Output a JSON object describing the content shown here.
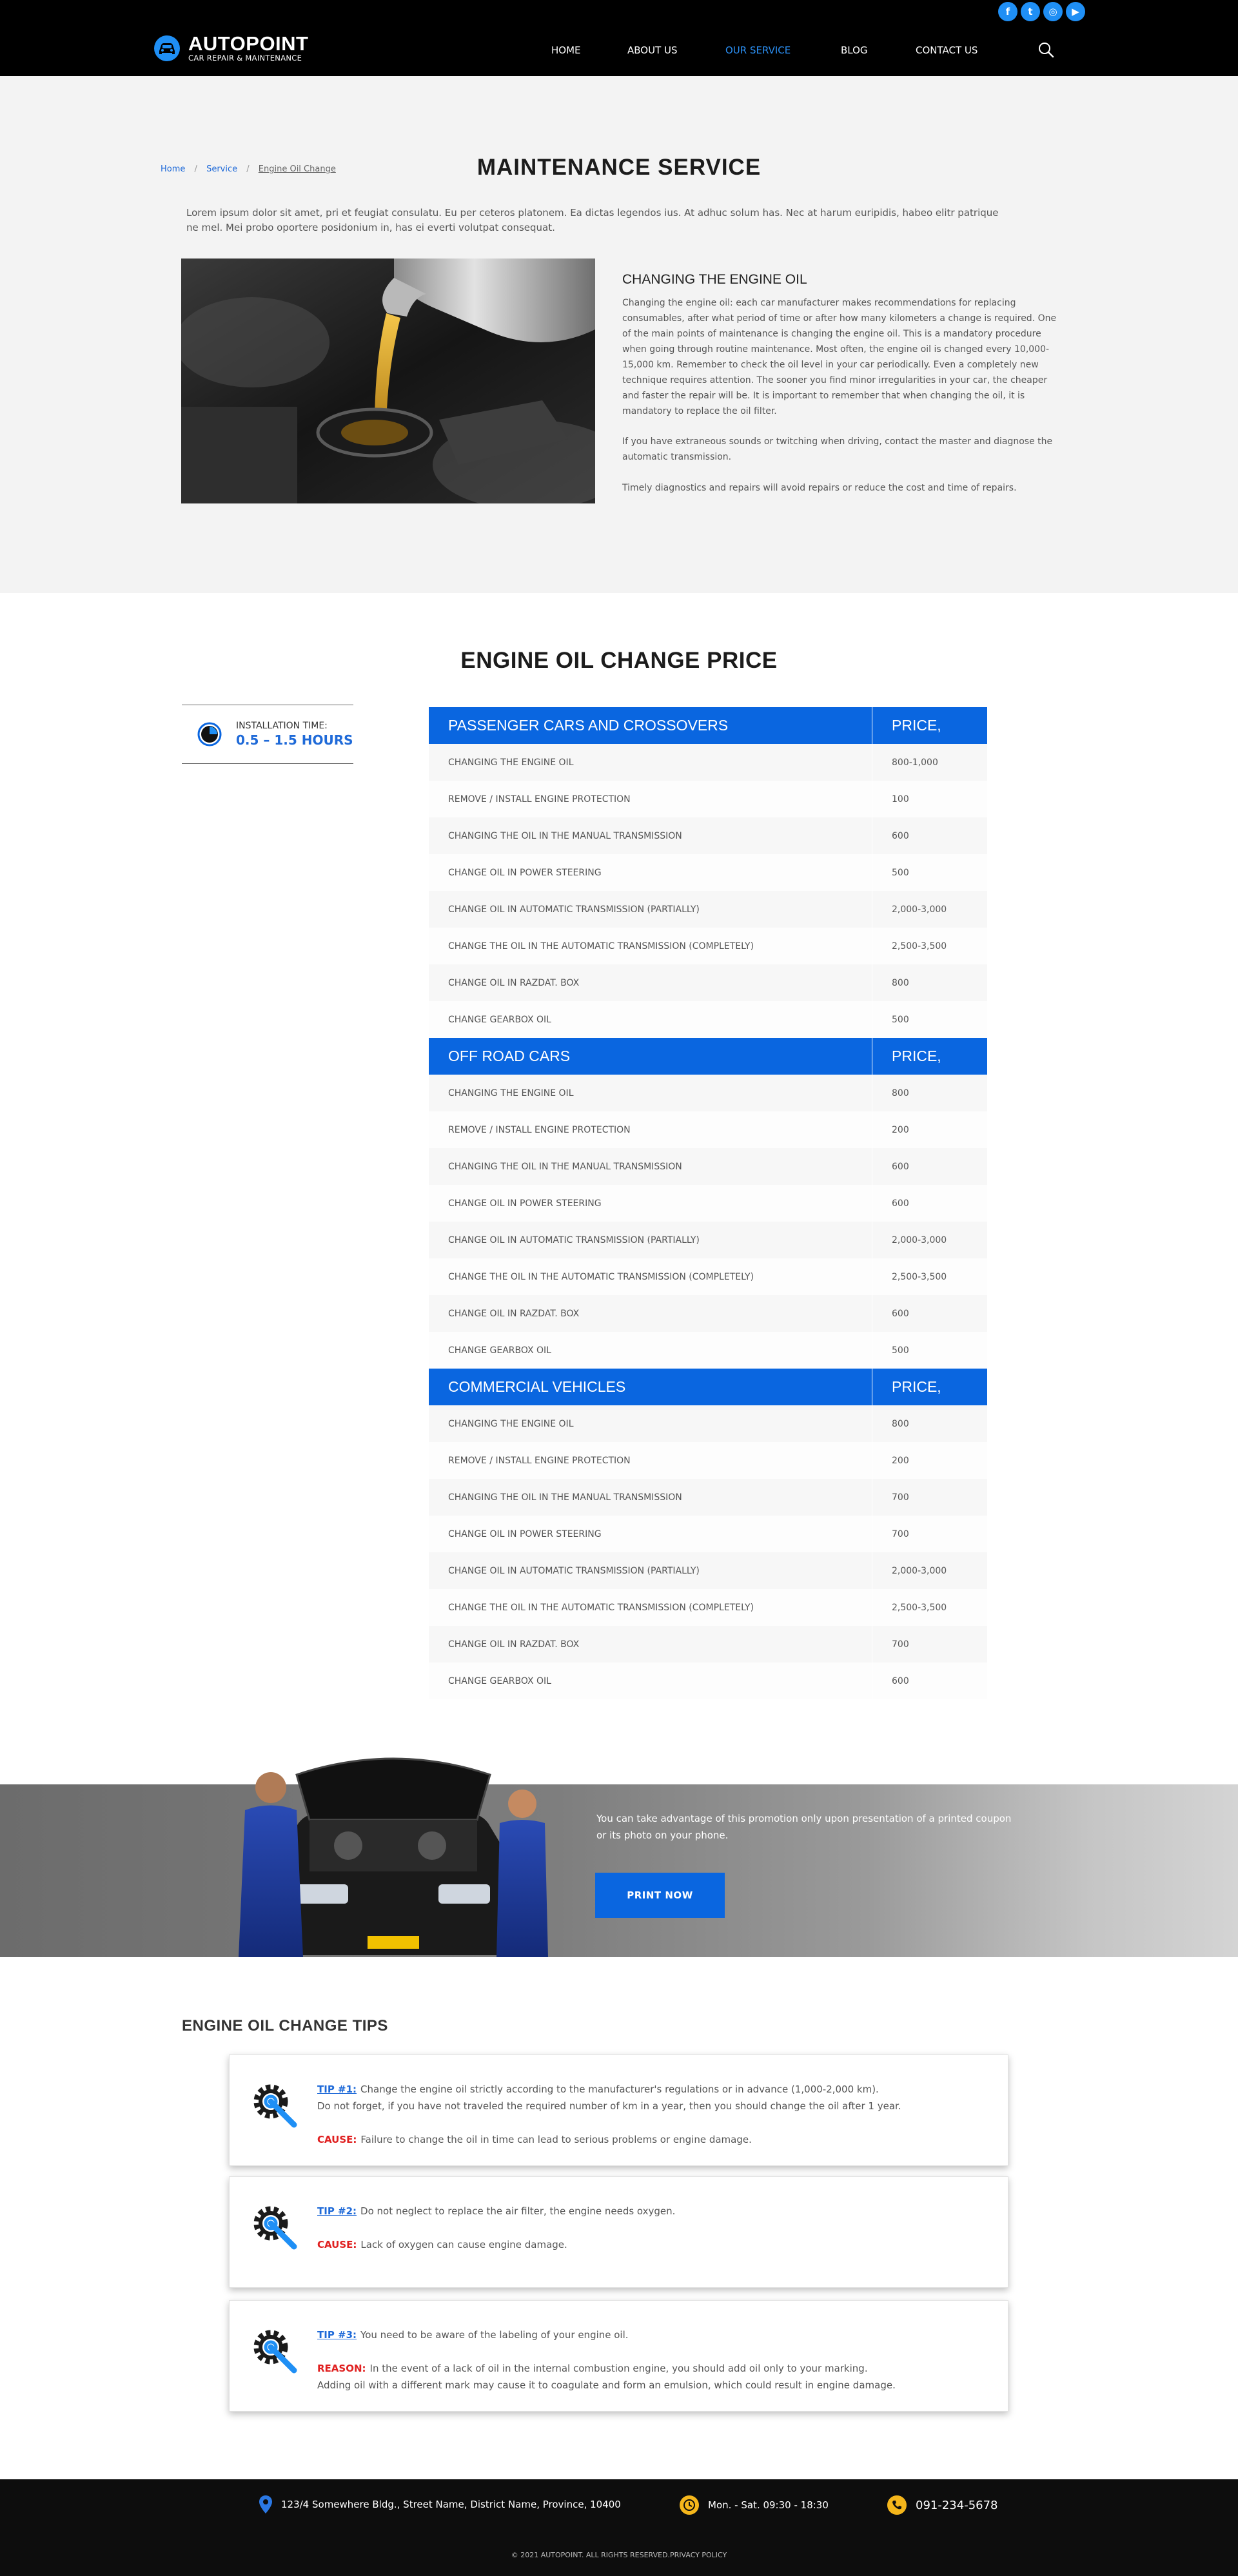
{
  "header": {
    "logo_name": "AUTOPOINT",
    "logo_tagline": "CAR REPAIR & MAINTENANCE",
    "social": [
      {
        "icon": "facebook-icon",
        "glyph": "f"
      },
      {
        "icon": "twitter-icon",
        "glyph": "t"
      },
      {
        "icon": "instagram-icon",
        "glyph": "◎"
      },
      {
        "icon": "youtube-icon",
        "glyph": "▶"
      }
    ],
    "nav": [
      "HOME",
      "ABOUT US",
      "OUR SERVICE",
      "BLOG",
      "CONTACT US"
    ],
    "active_nav": "OUR SERVICE",
    "accent": "#2b90f5"
  },
  "breadcrumb": [
    "Home",
    "Service",
    "Engine Oil Change"
  ],
  "intro": {
    "title": "MAINTENANCE SERVICE",
    "text": "Lorem ipsum dolor sit amet, pri et feugiat consulatu. Eu per ceteros platonem. Ea dictas legendos ius. At adhuc solum has. Nec at harum euripidis, habeo elitr patrique ne mel. Mei probo oportere posidonium in, has ei everti volutpat consequat."
  },
  "article": {
    "heading": "CHANGING THE ENGINE OIL",
    "p1": "Changing the engine oil: each car manufacturer makes recommendations for replacing consumables, after what period of time or after how many kilometers a change is required. One of the main points of maintenance is changing the engine oil. This is a mandatory procedure when going through routine maintenance. Most often, the engine oil is changed every 10,000-15,000 km. Remember to check the oil level in your car periodically. Even a completely new technique requires attention. The sooner you find minor irregularities in your car, the cheaper and faster the repair will be. It is important to remember that when changing the oil, it is mandatory to replace the oil filter.",
    "p2": "If you have extraneous sounds or twitching when driving, contact the master and diagnose the automatic transmission.",
    "p3": "Timely diagnostics and repairs will avoid repairs or reduce the cost and time of repairs."
  },
  "prices": {
    "title": "ENGINE OIL CHANGE PRICE",
    "install_label": "INSTALLATION TIME:",
    "install_value": "0.5 – 1.5 HOURS",
    "price_col": "PRICE,",
    "groups": [
      {
        "name": "PASSENGER CARS AND CROSSOVERS",
        "rows": [
          [
            "CHANGING THE ENGINE OIL",
            "800-1,000"
          ],
          [
            "REMOVE / INSTALL ENGINE PROTECTION",
            "100"
          ],
          [
            "CHANGING THE OIL IN THE MANUAL TRANSMISSION",
            "600"
          ],
          [
            "CHANGE OIL IN POWER STEERING",
            "500"
          ],
          [
            "CHANGE OIL IN AUTOMATIC TRANSMISSION (PARTIALLY)",
            "2,000-3,000"
          ],
          [
            "CHANGE THE OIL IN THE AUTOMATIC TRANSMISSION (COMPLETELY)",
            "2,500-3,500"
          ],
          [
            "CHANGE OIL IN RAZDAT. BOX",
            "800"
          ],
          [
            "CHANGE GEARBOX OIL",
            "500"
          ]
        ]
      },
      {
        "name": "OFF ROAD CARS",
        "rows": [
          [
            "CHANGING THE ENGINE OIL",
            "800"
          ],
          [
            "REMOVE / INSTALL ENGINE PROTECTION",
            "200"
          ],
          [
            "CHANGING THE OIL IN THE MANUAL TRANSMISSION",
            "600"
          ],
          [
            "CHANGE OIL IN POWER STEERING",
            "600"
          ],
          [
            "CHANGE OIL IN AUTOMATIC TRANSMISSION (PARTIALLY)",
            "2,000-3,000"
          ],
          [
            "CHANGE THE OIL IN THE AUTOMATIC TRANSMISSION (COMPLETELY)",
            "2,500-3,500"
          ],
          [
            "CHANGE OIL IN RAZDAT. BOX",
            "600"
          ],
          [
            "CHANGE GEARBOX OIL",
            "500"
          ]
        ]
      },
      {
        "name": "COMMERCIAL VEHICLES",
        "rows": [
          [
            "CHANGING THE ENGINE OIL",
            "800"
          ],
          [
            "REMOVE / INSTALL ENGINE PROTECTION",
            "200"
          ],
          [
            "CHANGING THE OIL IN THE MANUAL TRANSMISSION",
            "700"
          ],
          [
            "CHANGE OIL IN POWER STEERING",
            "700"
          ],
          [
            "CHANGE OIL IN AUTOMATIC TRANSMISSION (PARTIALLY)",
            "2,000-3,000"
          ],
          [
            "CHANGE THE OIL IN THE AUTOMATIC TRANSMISSION (COMPLETELY)",
            "2,500-3,500"
          ],
          [
            "CHANGE OIL IN RAZDAT. BOX",
            "700"
          ],
          [
            "CHANGE GEARBOX OIL",
            "600"
          ]
        ]
      }
    ]
  },
  "promo": {
    "text": "You can take advantage of this promotion only upon presentation of a printed coupon or its photo on your phone.",
    "button": "PRINT NOW"
  },
  "tips": {
    "title": "ENGINE OIL CHANGE TIPS",
    "items": [
      {
        "label": "TIP #1:",
        "text": "Change the engine oil strictly according to the manufacturer's regulations or in advance (1,000-2,000 km).",
        "text2": "Do not forget, if you have not traveled the required number of km in a year, then you should change the oil after 1 year.",
        "cause_label": "CAUSE:",
        "cause": "Failure to change the oil in time can lead to serious problems or engine damage.",
        "cause2": ""
      },
      {
        "label": "TIP #2:",
        "text": "Do not neglect to replace the air filter, the engine needs oxygen.",
        "text2": "",
        "cause_label": "CAUSE:",
        "cause": "Lack of oxygen can cause engine damage.",
        "cause2": ""
      },
      {
        "label": "TIP #3:",
        "text": "You need to be aware of the labeling of your engine oil.",
        "text2": "",
        "cause_label": "REASON:",
        "cause": "In the event of a lack of oil in the internal combustion engine, you should add oil only to your marking.",
        "cause2": "Adding oil with a different mark may cause it to coagulate and form an emulsion, which could result in engine damage."
      }
    ]
  },
  "footer": {
    "address": "123/4 Somewhere Bldg., Street Name, District Name, Province, 10400",
    "hours": "Mon. - Sat.  09:30 - 18:30",
    "phone": "091-234-5678",
    "copyright": "© 2021 AUTOPOINT. ALL RIGHTS RESERVED.PRIVACY POLICY"
  }
}
